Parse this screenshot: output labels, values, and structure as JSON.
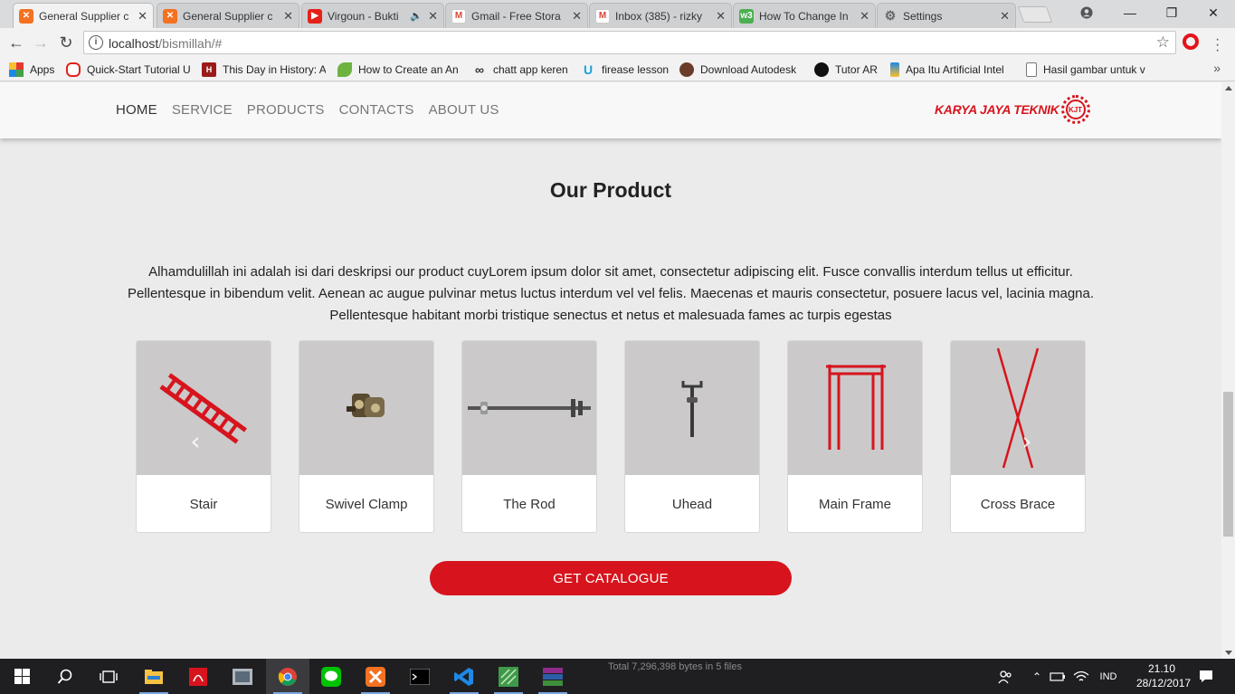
{
  "browser": {
    "tabs": [
      {
        "title": "General Supplier c",
        "icon": "xampp-icon",
        "color": "#f37121",
        "active": true
      },
      {
        "title": "General Supplier c",
        "icon": "xampp-icon",
        "color": "#f37121",
        "active": false
      },
      {
        "title": "Virgoun - Bukti",
        "icon": "youtube-icon",
        "color": "#e62117",
        "active": false,
        "audio": "🔈"
      },
      {
        "title": "Gmail - Free Stora",
        "icon": "gmail-icon",
        "color": "#d44638",
        "active": false
      },
      {
        "title": "Inbox (385) - rizky",
        "icon": "gmail-icon",
        "color": "#d44638",
        "active": false
      },
      {
        "title": "How To Change In",
        "icon": "w3schools-icon",
        "color": "#4caf50",
        "active": false
      },
      {
        "title": "Settings",
        "icon": "gear-icon",
        "color": "#666666",
        "active": false
      }
    ],
    "close_glyph": "✕",
    "url_host": "localhost",
    "url_path": "/bismillah/#",
    "bookmarks": [
      {
        "label": "Apps",
        "icon": "apps-grid-icon"
      },
      {
        "label": "Quick-Start Tutorial U",
        "icon": "oracle-icon"
      },
      {
        "label": "This Day in History: A",
        "icon": "history-icon"
      },
      {
        "label": "How to Create an An",
        "icon": "leaf-icon"
      },
      {
        "label": "chatt app keren",
        "icon": "infinity-icon"
      },
      {
        "label": "firease lesson",
        "icon": "udemy-icon"
      },
      {
        "label": "Download Autodesk",
        "icon": "autodesk-icon"
      },
      {
        "label": "Tutor AR",
        "icon": "unity-icon"
      },
      {
        "label": "Apa Itu Artificial Intel",
        "icon": "bookmark-icon"
      },
      {
        "label": "Hasil gambar untuk v",
        "icon": "page-icon"
      }
    ],
    "more_glyph": "»"
  },
  "site": {
    "nav": [
      {
        "label": "HOME",
        "active": true
      },
      {
        "label": "SERVICE",
        "active": false
      },
      {
        "label": "PRODUCTS",
        "active": false
      },
      {
        "label": "CONTACTS",
        "active": false
      },
      {
        "label": "ABOUT US",
        "active": false
      }
    ],
    "brand_name": "KARYA JAYA TEKNIK",
    "brand_mark": "KJT",
    "accent_color": "#d7141d",
    "section_title": "Our Product",
    "section_description": "Alhamdulillah ini adalah isi dari deskripsi our product cuyLorem ipsum dolor sit amet, consectetur adipiscing elit. Fusce convallis interdum tellus ut efficitur. Pellentesque in bibendum velit. Aenean ac augue pulvinar metus luctus interdum vel vel felis. Maecenas et mauris consectetur, posuere lacus vel, lacinia magna. Pellentesque habitant morbi tristique senectus et netus et malesuada fames ac turpis egestas",
    "products": [
      {
        "name": "Stair",
        "icon": "stair-image"
      },
      {
        "name": "Swivel Clamp",
        "icon": "swivel-clamp-image"
      },
      {
        "name": "The Rod",
        "icon": "rod-image"
      },
      {
        "name": "Uhead",
        "icon": "uhead-image"
      },
      {
        "name": "Main Frame",
        "icon": "main-frame-image"
      },
      {
        "name": "Cross Brace",
        "icon": "cross-brace-image"
      }
    ],
    "carousel_prev": "‹",
    "carousel_next": "›",
    "catalogue_button": "GET CATALOGUE"
  },
  "taskbar": {
    "status_text": "Total 7,296,398 bytes in 5 files",
    "language": "IND",
    "time": "21.10",
    "date": "28/12/2017"
  }
}
